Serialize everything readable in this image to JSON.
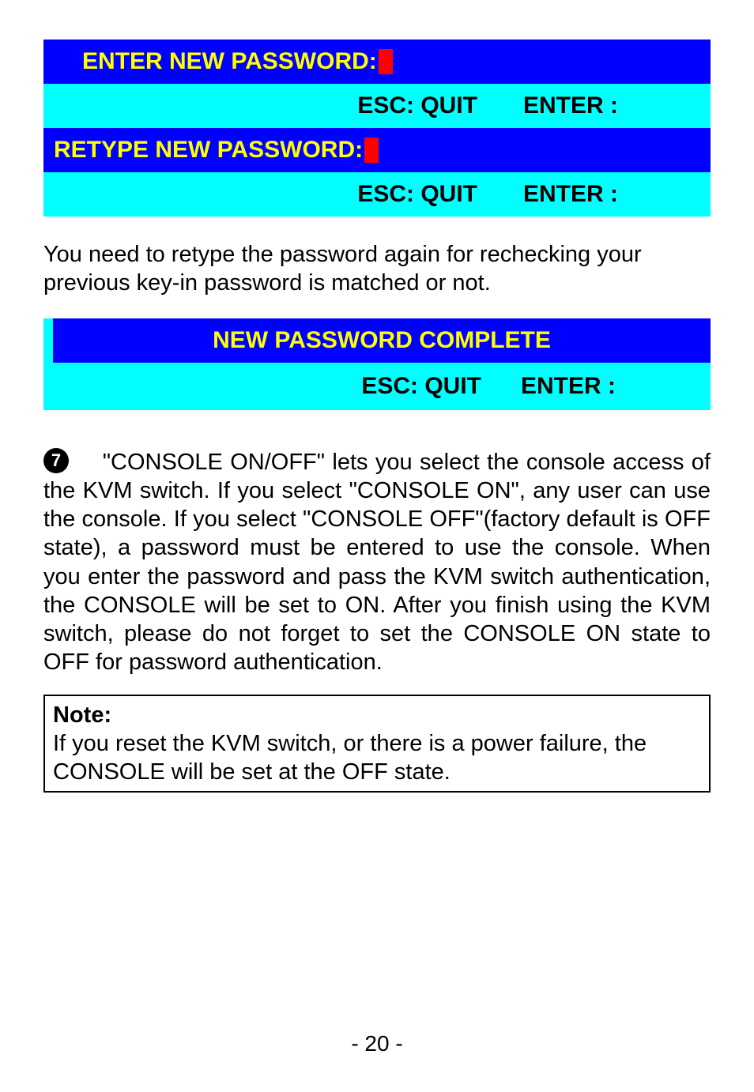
{
  "osd1": {
    "enter_new_password": "ENTER NEW PASSWORD:",
    "esc_quit_1": "ESC: QUIT",
    "enter_1": "ENTER :",
    "retype_new_password": "RETYPE NEW PASSWORD:",
    "esc_quit_2": "ESC: QUIT",
    "enter_2": "ENTER :"
  },
  "retype_text": "You need to retype the password again for rechecking your previous key-in password is matched or not.",
  "osd2": {
    "complete": "NEW PASSWORD COMPLETE",
    "esc_quit": "ESC: QUIT",
    "enter": "ENTER :"
  },
  "bullet_num": "7",
  "section_text": "  \"CONSOLE ON/OFF\" lets you select the console access of the KVM switch. If you select \"CONSOLE ON\", any user can use the console. If you select \"CONSOLE OFF\"(factory default is OFF state), a password must be entered to use the console. When you enter the password and pass the KVM switch authentication, the CONSOLE will be set to ON. After you finish using the KVM switch, please do not forget to set the CONSOLE ON state to OFF for password authentication.",
  "note": {
    "label": "Note:",
    "text": "If you reset the KVM switch, or there is a power failure, the CONSOLE will be set at the OFF state."
  },
  "page_number": "- 20 -"
}
